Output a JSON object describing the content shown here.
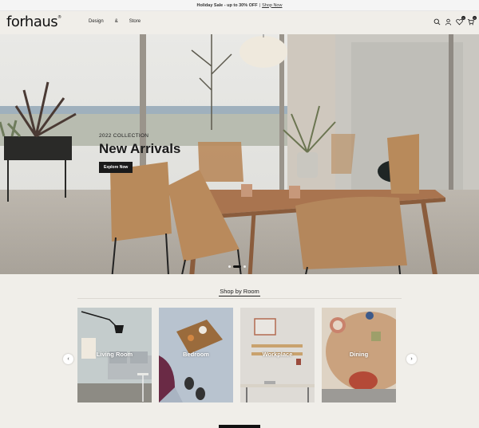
{
  "promo": {
    "bold": "Holiday Sale - up to 30% OFF",
    "separator": "|",
    "link": "Shop Now"
  },
  "header": {
    "logo": "forhaus",
    "logo_mark": "®",
    "nav": [
      "Design",
      "&",
      "Store"
    ],
    "icons": [
      "search-icon",
      "user-icon",
      "heart-icon",
      "cart-icon"
    ],
    "wishlist_count": "0",
    "cart_count": "0"
  },
  "hero": {
    "subtitle": "2022 COLLECTION",
    "title": "New Arrivals",
    "button": "Explore Now",
    "slides": 3,
    "active_slide": 2
  },
  "shop_by_room": {
    "title": "Shop by Room",
    "rooms": [
      {
        "label": "Living Room"
      },
      {
        "label": "Bedroom"
      },
      {
        "label": "Workplace"
      },
      {
        "label": "Dining"
      }
    ],
    "prev": "‹",
    "next": "›"
  },
  "colors": {
    "background": "#f0eee9",
    "accent": "#1a1a1a"
  }
}
